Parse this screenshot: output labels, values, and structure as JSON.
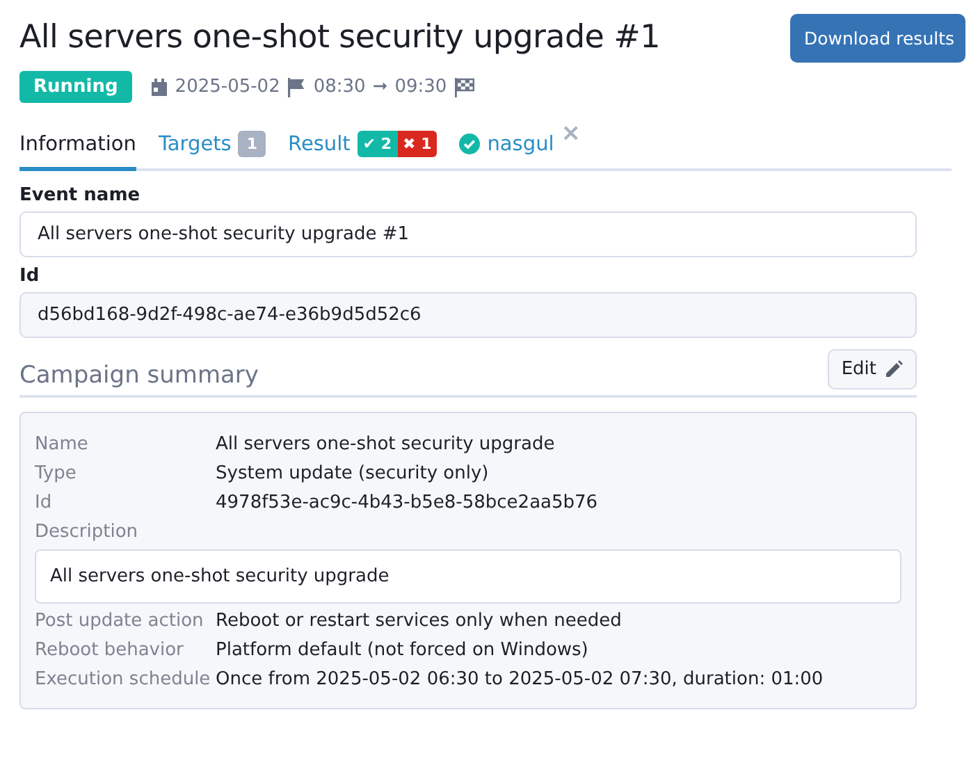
{
  "header": {
    "title": "All servers one-shot security upgrade #1",
    "download_button": "Download results",
    "status": {
      "label": "Running",
      "kind": "running"
    },
    "date": "2025-05-02",
    "start_time": "08:30",
    "arrow": "➞",
    "end_time": "09:30"
  },
  "tabs": [
    {
      "label": "Information",
      "selected": true
    },
    {
      "label": "Targets",
      "selected": false,
      "count": "1"
    },
    {
      "label": "Result",
      "selected": false,
      "success": "✔ 2",
      "failure": "✖ 1"
    },
    {
      "label": "nasgul",
      "selected": false,
      "closable": true,
      "close": "×"
    }
  ],
  "event_name": {
    "label": "Event name",
    "value": "All servers one-shot security upgrade #1"
  },
  "id_field": {
    "label": "Id",
    "value": "d56bd168-9d2f-498c-ae74-e36b9d5d52c6"
  },
  "summary": {
    "title": "Campaign summary",
    "edit_button": "Edit",
    "rows": [
      {
        "label": "Name",
        "value": "All servers one-shot security upgrade"
      },
      {
        "label": "Type",
        "value": "System update (security only)"
      },
      {
        "label": "Id",
        "value": "4978f53e-ac9c-4b43-b5e8-58bce2aa5b76"
      },
      {
        "label": "Description",
        "box": "All servers one-shot security upgrade"
      },
      {
        "label": "Post update action",
        "value": "Reboot or restart services only when needed"
      },
      {
        "label": "Reboot behavior",
        "value": "Platform default (not forced on Windows)"
      },
      {
        "label": "Execution schedule",
        "value": "Once from 2025-05-02 06:30 to 2025-05-02 07:30, duration: 01:00"
      }
    ]
  }
}
